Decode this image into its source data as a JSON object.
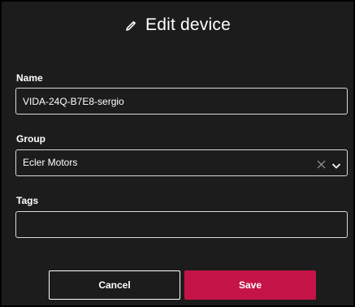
{
  "dialog": {
    "title": "Edit device",
    "title_icon": "pencil-icon"
  },
  "form": {
    "name": {
      "label": "Name",
      "value": "VIDA-24Q-B7E8-sergio"
    },
    "group": {
      "label": "Group",
      "selected": "Ecler Motors",
      "clear_icon": "close-icon",
      "toggle_icon": "chevron-down-icon"
    },
    "tags": {
      "label": "Tags",
      "value": ""
    }
  },
  "actions": {
    "cancel_label": "Cancel",
    "save_label": "Save"
  },
  "colors": {
    "background": "#1c1c1c",
    "field_border": "#d9d9d9",
    "primary": "#c41447",
    "text": "#ffffff"
  }
}
